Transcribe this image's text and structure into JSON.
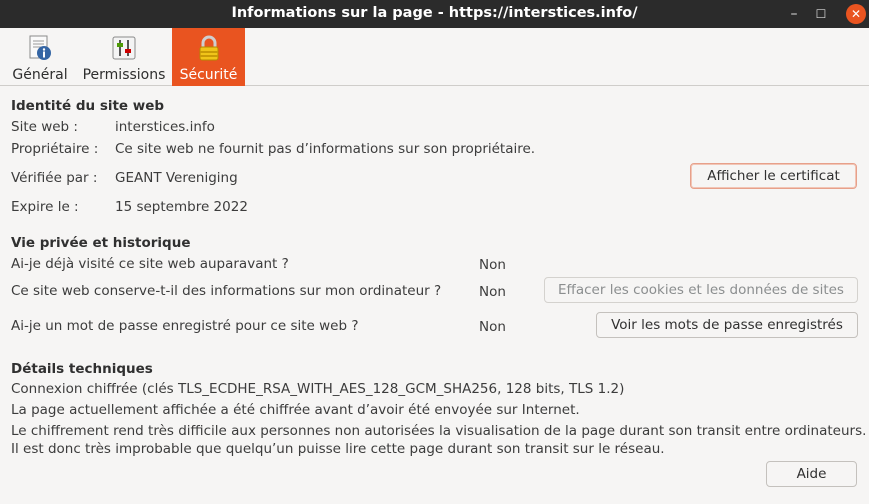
{
  "window": {
    "title": "Informations sur la page - https://interstices.info/"
  },
  "tabs": [
    {
      "label": "Général",
      "icon": "info-page-icon",
      "active": false
    },
    {
      "label": "Permissions",
      "icon": "permissions-icon",
      "active": false
    },
    {
      "label": "Sécurité",
      "icon": "lock-icon",
      "active": true
    }
  ],
  "identity": {
    "heading": "Identité du site web",
    "website_label": "Site web :",
    "website_value": "interstices.info",
    "owner_label": "Propriétaire :",
    "owner_value": "Ce site web ne fournit pas d’informations sur son propriétaire.",
    "verified_label": "Vérifiée par :",
    "verified_value": "GEANT Vereniging",
    "expires_label": "Expire le :",
    "expires_value": "15 septembre 2022",
    "view_cert_button": "Afficher le certificat"
  },
  "privacy": {
    "heading": "Vie privée et historique",
    "q1": "Ai-je déjà visité ce site web auparavant ?",
    "a1": "Non",
    "q2": "Ce site web conserve-t-il des informations sur mon ordinateur ?",
    "a2": "Non",
    "clear_button": "Effacer les cookies et les données de sites",
    "q3": "Ai-je un mot de passe enregistré pour ce site web ?",
    "a3": "Non",
    "passwords_button": "Voir les mots de passe enregistrés"
  },
  "technical": {
    "heading": "Détails techniques",
    "line1": "Connexion chiffrée (clés TLS_ECDHE_RSA_WITH_AES_128_GCM_SHA256, 128 bits, TLS 1.2)",
    "line2": "La page actuellement affichée a été chiffrée avant d’avoir été envoyée sur Internet.",
    "line3": "Le chiffrement rend très difficile aux personnes non autorisées la visualisation de la page durant son transit entre ordinateurs.",
    "line4": "Il est donc très improbable que quelqu’un puisse lire cette page durant son transit sur le réseau."
  },
  "help_button": "Aide",
  "colors": {
    "accent": "#e95420",
    "titlebar": "#2b2b2b",
    "background": "#f6f5f4"
  }
}
